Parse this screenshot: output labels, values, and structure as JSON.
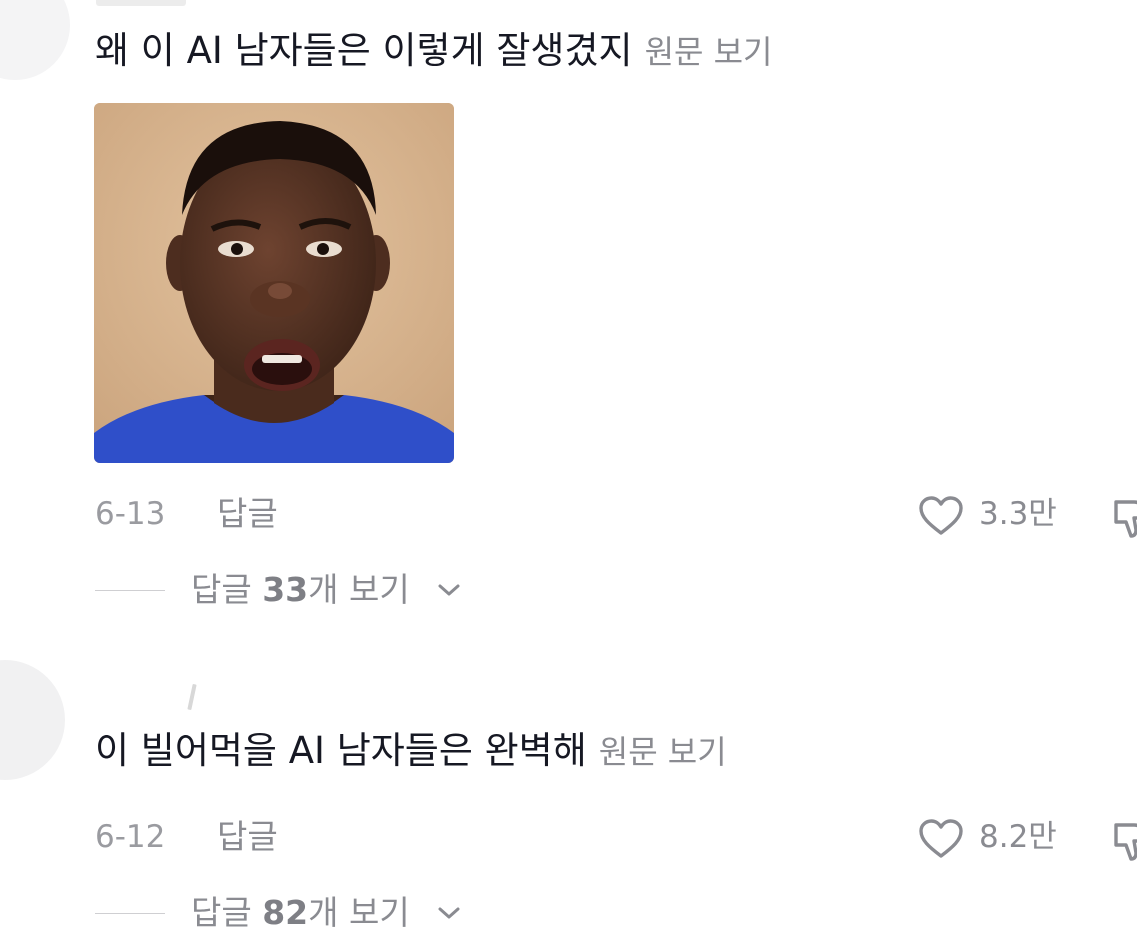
{
  "comments": [
    {
      "text": "왜 이 AI 남자들은 이렇게 잘생겼지",
      "translate_label": "원문 보기",
      "date": "6-13",
      "reply_label": "답글",
      "likes": "3.3만",
      "replies_prefix": "답글 ",
      "replies_count": "33",
      "replies_suffix": "개 보기",
      "has_image": true
    },
    {
      "text": "이 빌어먹을 AI 남자들은 완벽해",
      "translate_label": "원문 보기",
      "date": "6-12",
      "reply_label": "답글",
      "likes": "8.2만",
      "replies_prefix": "답글 ",
      "replies_count": "82",
      "replies_suffix": "개 보기",
      "has_image": false
    }
  ],
  "icons": {
    "like": "heart-outline-icon",
    "dislike": "thumbs-down-icon",
    "expand": "chevron-down-icon"
  },
  "colors": {
    "text_primary": "#161823",
    "text_secondary": "#8a8b91",
    "shirt_blue": "#2f4fc9"
  }
}
